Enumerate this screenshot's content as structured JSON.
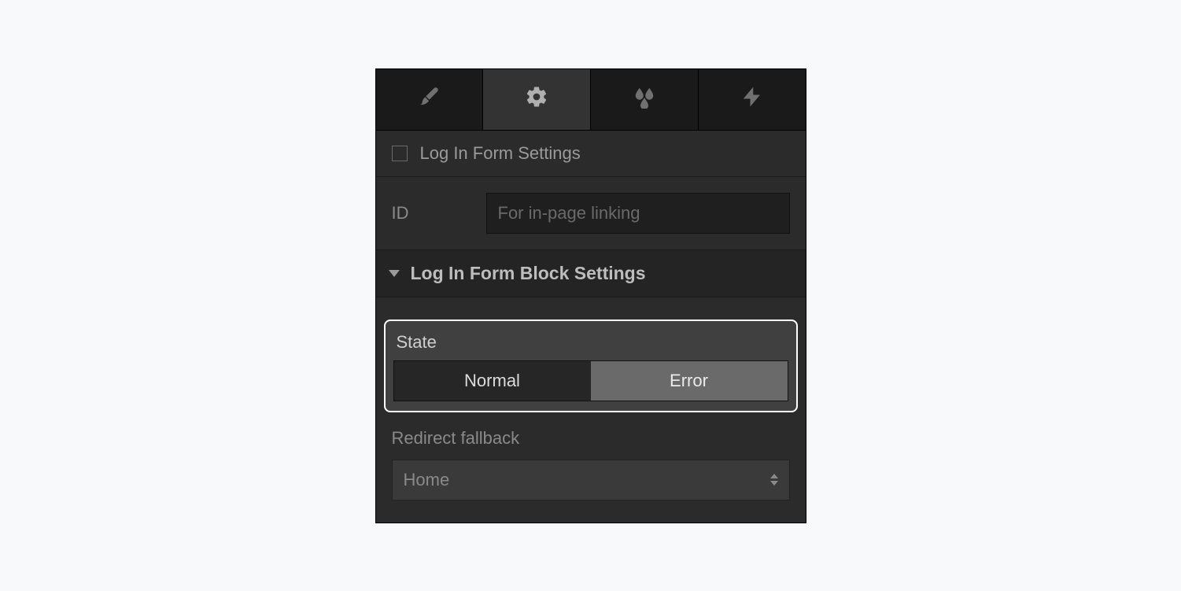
{
  "tabs": {
    "brush": {
      "active": false
    },
    "settings": {
      "active": true
    },
    "effects": {
      "active": false
    },
    "interactions": {
      "active": false
    }
  },
  "form_settings": {
    "checkbox_checked": false,
    "label": "Log In Form Settings"
  },
  "id_field": {
    "label": "ID",
    "placeholder": "For in-page linking",
    "value": ""
  },
  "block_settings": {
    "title": "Log In Form Block Settings",
    "expanded": true
  },
  "state": {
    "label": "State",
    "options": {
      "normal": "Normal",
      "error": "Error"
    },
    "selected": "error"
  },
  "redirect_fallback": {
    "label": "Redirect fallback",
    "value": "Home"
  }
}
